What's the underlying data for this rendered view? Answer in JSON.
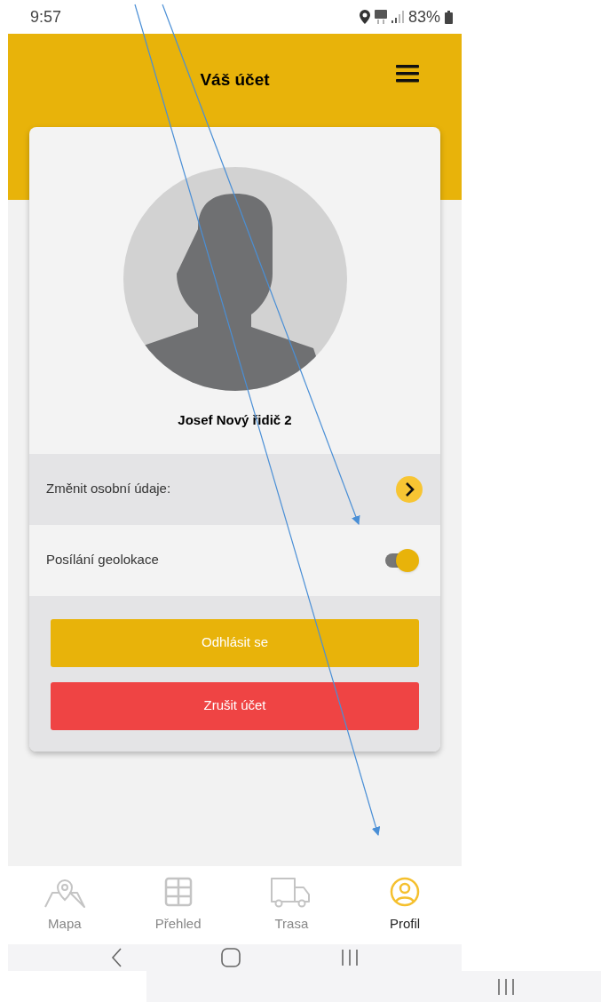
{
  "status_bar": {
    "time": "9:57",
    "battery": "83%"
  },
  "header": {
    "title": "Váš účet"
  },
  "profile": {
    "name": "Josef Nový řidič 2"
  },
  "settings": [
    {
      "kind": "link",
      "label": "Změnit osobní údaje:"
    },
    {
      "kind": "toggle",
      "label": "Posílání geolokace",
      "on": true
    }
  ],
  "buttons": [
    {
      "kind": "primary",
      "label": "Odhlásit se"
    },
    {
      "kind": "danger",
      "label": "Zrušit účet"
    }
  ],
  "bottom_nav": [
    {
      "kind": "map",
      "label": "Mapa",
      "selected": false
    },
    {
      "kind": "grid",
      "label": "Přehled",
      "selected": false
    },
    {
      "kind": "truck",
      "label": "Trasa",
      "selected": false
    },
    {
      "kind": "profile",
      "label": "Profil",
      "selected": true
    }
  ]
}
